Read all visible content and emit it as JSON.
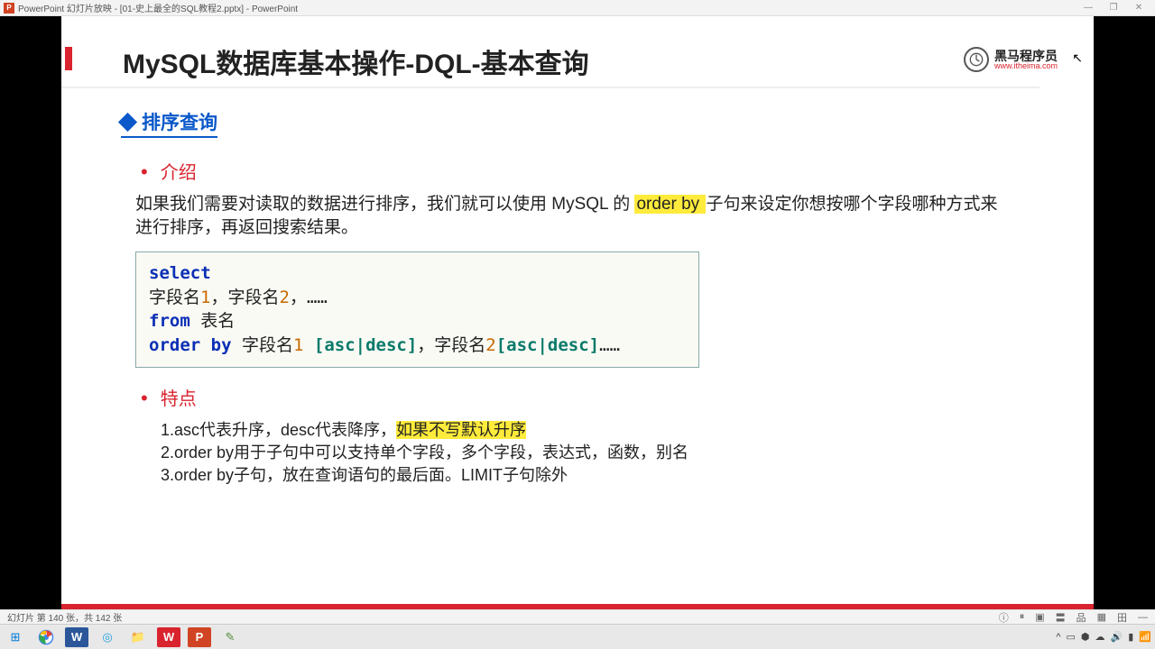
{
  "titlebar": {
    "app_icon_letter": "P",
    "title": "PowerPoint 幻灯片放映 - [01-史上最全的SQL教程2.pptx] - PowerPoint",
    "min": "—",
    "max": "❐",
    "close": "✕"
  },
  "slide": {
    "title": "MySQL数据库基本操作-DQL-基本查询",
    "brand_cn": "黑马程序员",
    "brand_url": "www.itheima.com",
    "section": "排序查询",
    "sub1": "介绍",
    "para_pre": "如果我们需要对读取的数据进行排序，我们就可以使用 MySQL 的 ",
    "para_hl": "order by ",
    "para_post": "子句来设定你想按哪个字段哪种方式来进行排序，再返回搜索结果。",
    "code": {
      "l1_kw": "select",
      "l2_a": " 字段名",
      "l2_n1": "1",
      "l2_b": "，字段名",
      "l2_n2": "2",
      "l2_c": "，……",
      "l3_kw": "from",
      "l3_t": " 表名",
      "l4_kw": "order by",
      "l4_a": " 字段名",
      "l4_n1": "1",
      "l4_sp": " ",
      "l4_br1": "[asc|desc]",
      "l4_b": "，字段名",
      "l4_n2": "2",
      "l4_br2": "[asc|desc]",
      "l4_c": "……"
    },
    "sub2": "特点",
    "feat1_a": "1.asc代表升序，desc代表降序，",
    "feat1_hl": "如果不写默认升序",
    "feat2": "2.order by用于子句中可以支持单个字段，多个字段，表达式，函数，别名",
    "feat3": "3.order by子句，放在查询语句的最后面。LIMIT子句除外"
  },
  "statusbar": {
    "left": "幻灯片 第 140 张，共 142 张",
    "icons": [
      "ⓘ",
      "⏸",
      "▣",
      "〓",
      "品",
      "▦",
      "田",
      "—"
    ]
  },
  "taskbar": {
    "tray_up": "^",
    "items": {
      "win": "⊞",
      "chrome": "◉",
      "word": "W",
      "edge": "◎",
      "folder": "📁",
      "wps": "W",
      "ppt": "P",
      "misc": "✎"
    }
  }
}
